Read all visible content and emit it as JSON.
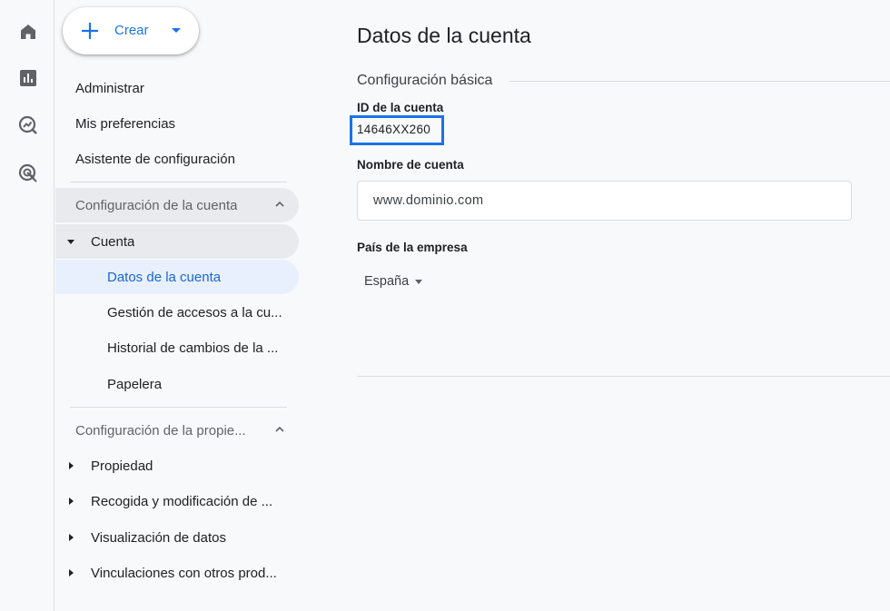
{
  "create_button": {
    "label": "Crear"
  },
  "rail": [
    {
      "icon": "home-icon"
    },
    {
      "icon": "reports-icon"
    },
    {
      "icon": "explore-icon"
    },
    {
      "icon": "advertising-icon"
    }
  ],
  "sidebar": {
    "top_items": [
      "Administrar",
      "Mis preferencias",
      "Asistente de configuración"
    ],
    "account_section": {
      "title": "Configuración de la cuenta",
      "group": "Cuenta",
      "items": [
        "Datos de la cuenta",
        "Gestión de accesos a la cu...",
        "Historial de cambios de la ...",
        "Papelera"
      ]
    },
    "property_section": {
      "title": "Configuración de la propie...",
      "items": [
        "Propiedad",
        "Recogida y modificación de ...",
        "Visualización de datos",
        "Vinculaciones con otros prod..."
      ]
    }
  },
  "main": {
    "title": "Datos de la cuenta",
    "section_title": "Configuración básica",
    "account_id_label": "ID de la cuenta",
    "account_id_value": "14646XX260",
    "account_name_label": "Nombre de cuenta",
    "account_name_value": "www.dominio.com",
    "country_label": "País de la empresa",
    "country_value": "España"
  },
  "colors": {
    "accent": "#1a73e8",
    "selected_bg": "#e8f0fe",
    "expanded_bg": "#e8eaed"
  }
}
